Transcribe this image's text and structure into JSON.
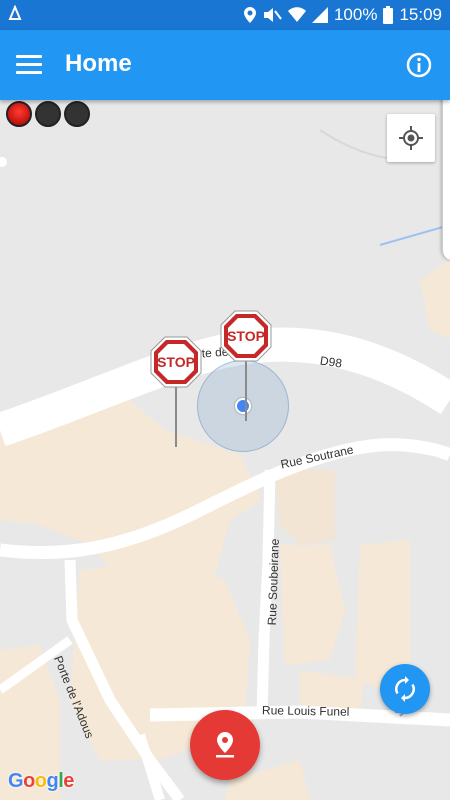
{
  "status_bar": {
    "battery": "100%",
    "time": "15:09"
  },
  "app_bar": {
    "title": "Home"
  },
  "map": {
    "street_labels": {
      "route_fragment": "ute de  nes",
      "d98": "D98",
      "rue_soutrane": "Rue Soutrane",
      "rue_soubeirane": "Rue Soubeirane",
      "porte_adous": "Porte de l'Adous",
      "rue_louis_funel": "Rue Louis Funel"
    },
    "markers": [
      {
        "label": "STOP"
      },
      {
        "label": "STOP"
      }
    ],
    "attribution": "Google"
  },
  "colors": {
    "app_bar": "#2196f3",
    "status_bar": "#1976d2",
    "fab_add": "#e53935",
    "fab_refresh": "#2196f3",
    "stop_sign": "#c62828",
    "user_location": "#4285f4"
  },
  "icons": {
    "menu": "hamburger-icon",
    "info": "info-icon",
    "locate": "my-location-icon",
    "refresh": "sync-icon",
    "add_marker": "pin-drop-icon"
  }
}
